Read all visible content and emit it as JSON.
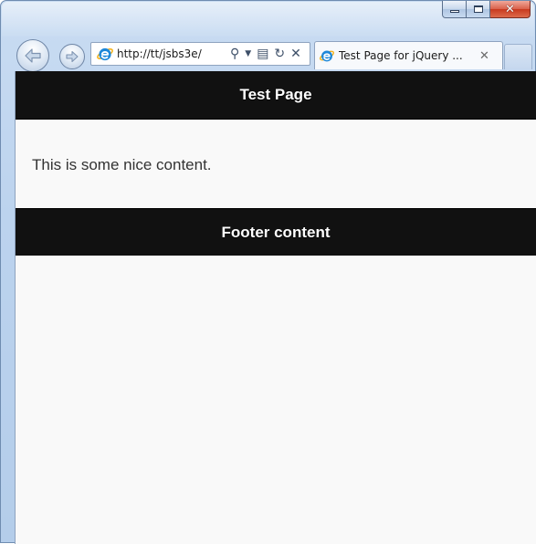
{
  "browser": {
    "address": {
      "url": "http://tt/jsbs3e/"
    },
    "tab": {
      "title": "Test Page for jQuery ...",
      "close_glyph": "✕"
    },
    "caption": {
      "close_glyph": "✕"
    },
    "icons": {
      "back": "back-arrow-icon",
      "forward": "forward-arrow-icon",
      "site": "internet-explorer-icon",
      "search": "search-icon",
      "dropdown": "dropdown-arrow-icon",
      "compat": "compatibility-view-icon",
      "refresh": "refresh-icon",
      "stop": "stop-icon"
    },
    "address_tools": {
      "search": "⚲",
      "dropdown": "▼",
      "compat": "▤",
      "refresh": "↻",
      "stop": "✕"
    }
  },
  "page": {
    "header_title": "Test Page",
    "content_text": "This is some nice content.",
    "footer_text": "Footer content"
  },
  "colors": {
    "header_bg": "#111111",
    "page_bg": "#f9f9f9",
    "window_frame": "#bcd3ee",
    "close_button": "#c8391f"
  }
}
